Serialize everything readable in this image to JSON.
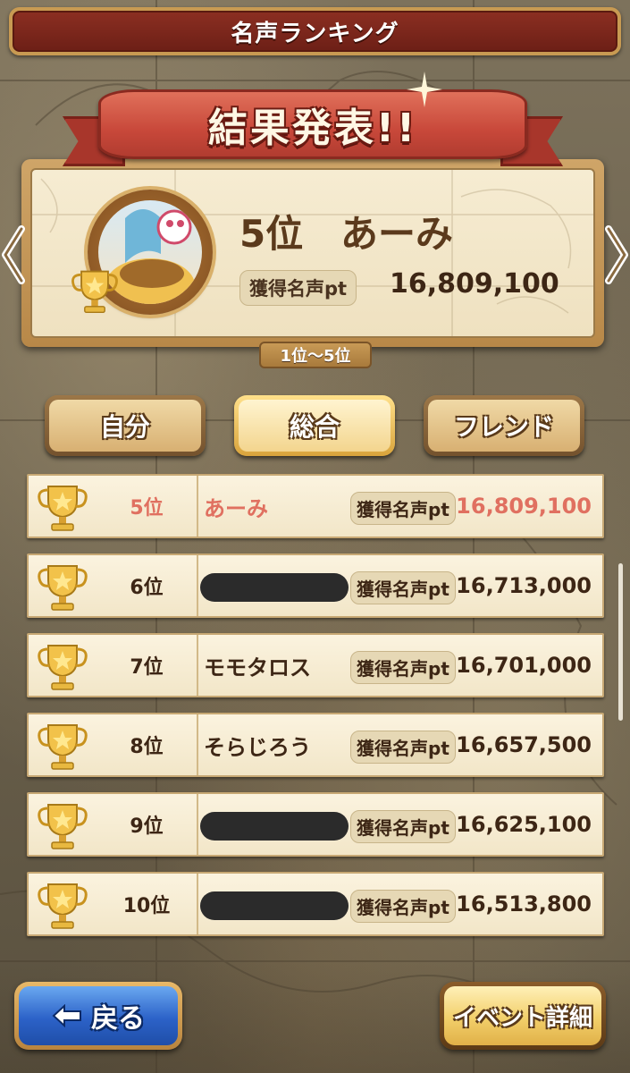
{
  "header": {
    "title": "名声ランキング"
  },
  "result": {
    "banner": "結果発表!!",
    "rank": "5位",
    "name": "あーみ",
    "pt_label": "獲得名声pt",
    "pt_value": "16,809,100",
    "range": "1位〜5位"
  },
  "tabs": [
    {
      "label": "自分",
      "active": false
    },
    {
      "label": "総合",
      "active": true
    },
    {
      "label": "フレンド",
      "active": false
    }
  ],
  "rows": [
    {
      "rank": "5位",
      "name": "あーみ",
      "pt_label": "獲得名声pt",
      "pt_value": "16,809,100",
      "redacted": false,
      "self": true
    },
    {
      "rank": "6位",
      "name": "",
      "pt_label": "獲得名声pt",
      "pt_value": "16,713,000",
      "redacted": true,
      "self": false
    },
    {
      "rank": "7位",
      "name": "モモタロス",
      "pt_label": "獲得名声pt",
      "pt_value": "16,701,000",
      "redacted": false,
      "self": false
    },
    {
      "rank": "8位",
      "name": "そらじろう",
      "pt_label": "獲得名声pt",
      "pt_value": "16,657,500",
      "redacted": false,
      "self": false
    },
    {
      "rank": "9位",
      "name": "",
      "pt_label": "獲得名声pt",
      "pt_value": "16,625,100",
      "redacted": true,
      "self": false
    },
    {
      "rank": "10位",
      "name": "",
      "pt_label": "獲得名声pt",
      "pt_value": "16,513,800",
      "redacted": true,
      "self": false
    }
  ],
  "buttons": {
    "back": "戻る",
    "detail": "イベント詳細"
  },
  "icons": {
    "trophy": "trophy-icon",
    "back_arrow": "arrow-left-icon",
    "nav_prev": "chevron-left-icon",
    "nav_next": "chevron-right-icon"
  },
  "colors": {
    "self_highlight": "#e07060",
    "title_bar": "#7a271b",
    "ribbon": "#c8483a"
  }
}
